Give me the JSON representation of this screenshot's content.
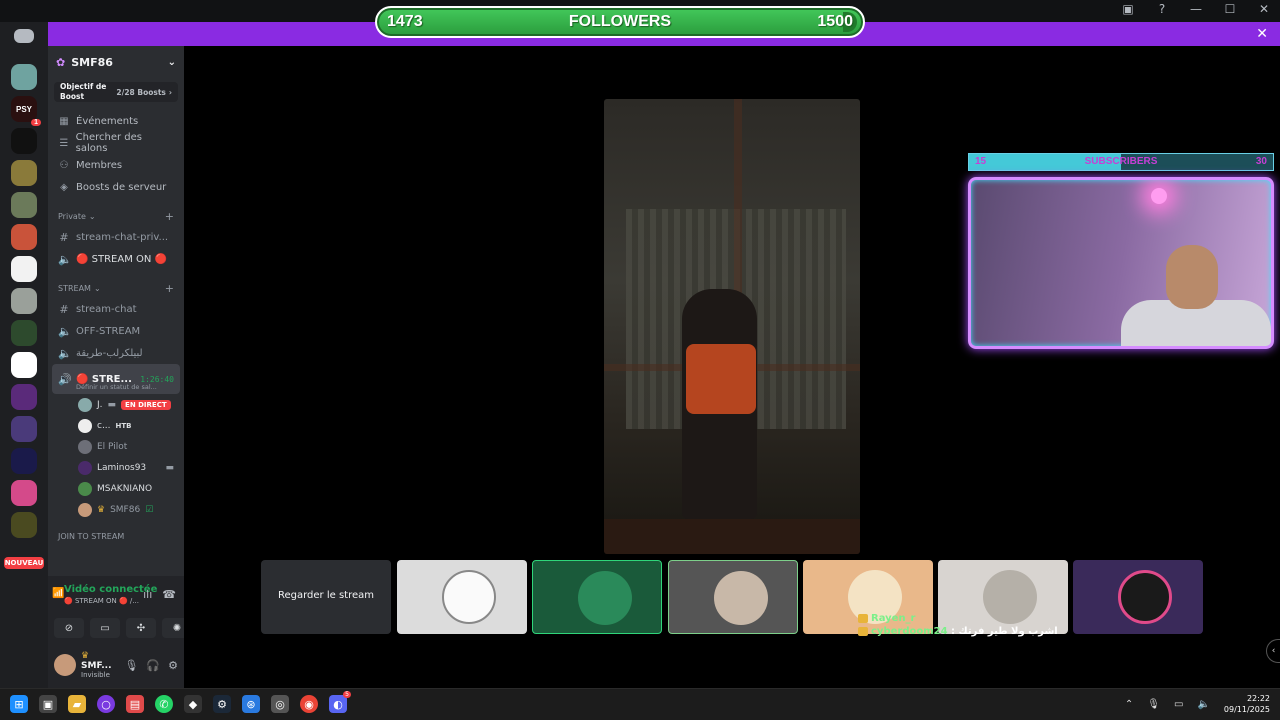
{
  "followers_bar": {
    "current": "1473",
    "label": "FOLLOWERS",
    "goal": "1500"
  },
  "subscribers_bar": {
    "current": "15",
    "label": "SUBSCRIBERS",
    "goal": "30",
    "progress": 0.5
  },
  "window": {
    "icons": [
      "inbox-icon",
      "help-icon",
      "minimize-icon",
      "maximize-icon",
      "close-icon"
    ]
  },
  "rail": {
    "badges": {
      "psy": "1"
    },
    "psy_label": "PSY",
    "nouveau": "NOUVEAU"
  },
  "server": {
    "name": "SMF86",
    "boost_label": "Objectif de Boost",
    "boost_count": "2/28 Boosts",
    "nav": [
      {
        "label": "Événements"
      },
      {
        "label": "Chercher des salons"
      },
      {
        "label": "Membres"
      },
      {
        "label": "Boosts de serveur"
      }
    ],
    "categories": {
      "private": "Private",
      "stream": "STREAM",
      "join": "JOIN TO STREAM"
    },
    "private_channels": [
      {
        "label": "stream-chat-priv..."
      },
      {
        "label": "🔴 STREAM ON 🔴"
      }
    ],
    "stream_channels": [
      {
        "label": "stream-chat"
      },
      {
        "label": "OFF-STREAM"
      },
      {
        "label": "لبيلكرلب-طريقة"
      }
    ],
    "active_voice": {
      "label": "🔴 STRE...",
      "time": "1:26:40",
      "status": "Définir un statut de sal..."
    },
    "voice_users": [
      {
        "name": "J.",
        "tag": "EN DIRECT"
      },
      {
        "name": "c...",
        "tag": "HTB"
      },
      {
        "name": "El Pilot",
        "tag": ""
      },
      {
        "name": "Laminos93",
        "tag": ""
      },
      {
        "name": "MSAKNIANO",
        "tag": ""
      },
      {
        "name": "SMF86",
        "tag": ""
      }
    ]
  },
  "voice_panel": {
    "status": "Vidéo connectée",
    "channel": "🔴 STREAM ON 🔴 /..."
  },
  "user_panel": {
    "name": "SMF...",
    "status": "Invisible"
  },
  "tiles": {
    "watch_label": "Regarder le stream"
  },
  "chat_overlay": {
    "line1_name": "Rayen_r",
    "line2_name": "cyberdoom24",
    "line2_msg": ": اشرب ولا طير فرتك"
  },
  "taskbar": {
    "discord_badge": "5",
    "time": "22:22",
    "date": "09/11/2025"
  }
}
